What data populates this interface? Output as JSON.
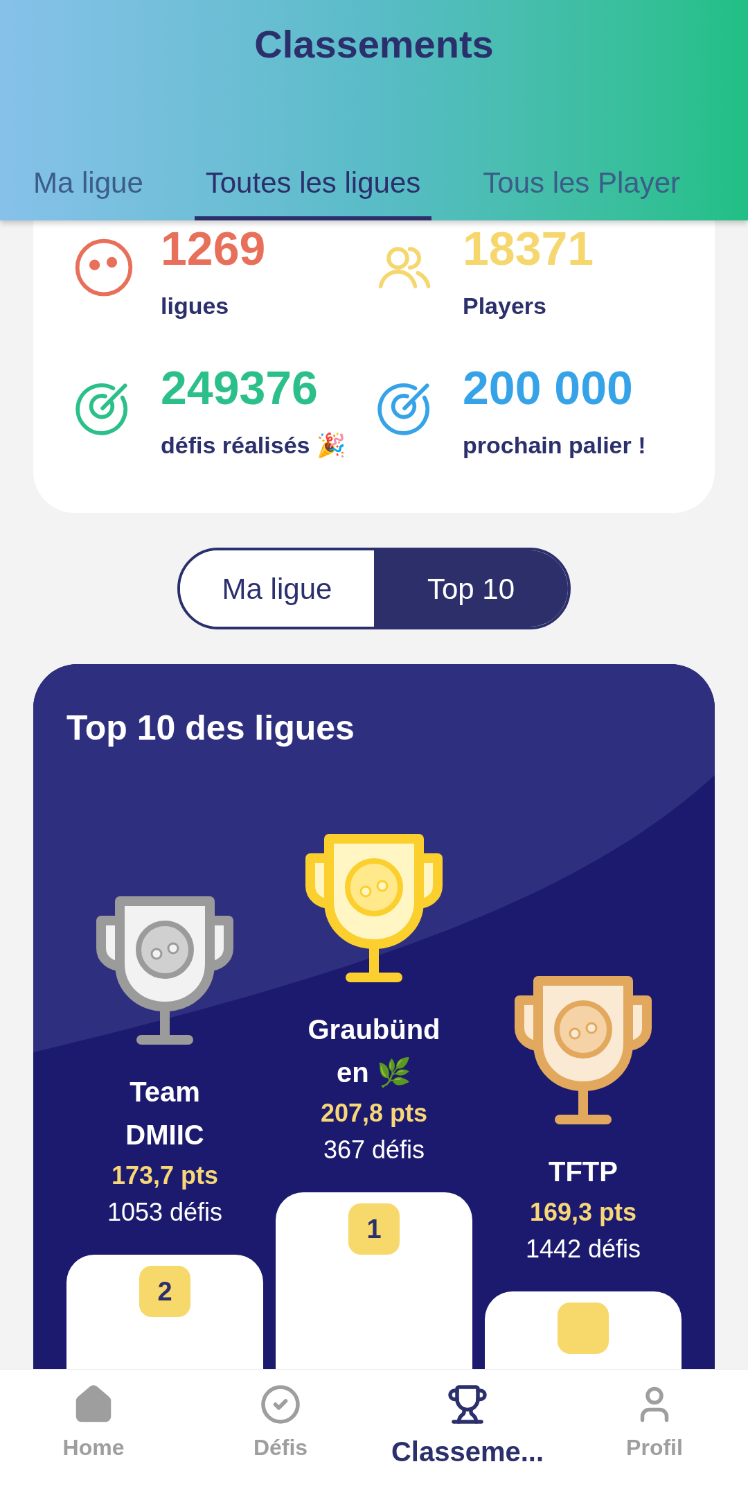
{
  "header": {
    "title": "Classements"
  },
  "tabs": [
    {
      "label": "Ma ligue",
      "selected": false
    },
    {
      "label": "Toutes les ligues",
      "selected": true
    },
    {
      "label": "Tous les Player",
      "selected": false
    }
  ],
  "stats": [
    {
      "value": "1269",
      "label": "ligues",
      "kind": "face",
      "color": "#e8705a"
    },
    {
      "value": "18371",
      "label": "Players",
      "kind": "users",
      "color": "#f5d76e"
    },
    {
      "value": "249376",
      "label": "défis réalisés 🎉",
      "kind": "target",
      "color": "#2bbf8a"
    },
    {
      "value": "200 000",
      "label": "prochain palier !",
      "kind": "target",
      "color": "#36a3e8"
    }
  ],
  "toggle": [
    {
      "label": "Ma ligue",
      "selected": false
    },
    {
      "label": "Top 10",
      "selected": true
    }
  ],
  "top10": {
    "title": "Top 10 des ligues",
    "podium": [
      {
        "kind": "silver",
        "name": "Team DMIIC",
        "points": "173,7 pts",
        "defis": "1053 défis",
        "rank": "2"
      },
      {
        "kind": "gold",
        "name": "Graubünd en 🌿",
        "points": "207,8 pts",
        "defis": "367 défis",
        "rank": "1"
      },
      {
        "kind": "bronze",
        "name": "TFTP",
        "points": "169,3 pts",
        "defis": "1442 défis"
      }
    ]
  },
  "nav": [
    {
      "label": "Home",
      "kind": "home",
      "selected": false
    },
    {
      "label": "Défis",
      "kind": "check",
      "selected": false
    },
    {
      "label": "Classeme...",
      "kind": "trophy",
      "selected": true
    },
    {
      "label": "Profil",
      "kind": "user",
      "selected": false
    }
  ]
}
